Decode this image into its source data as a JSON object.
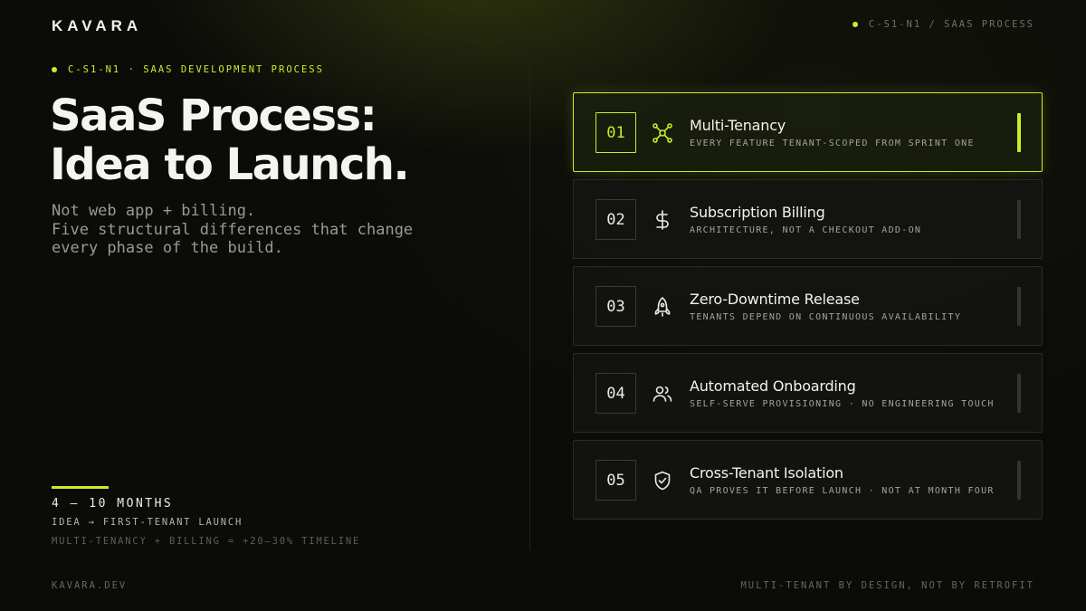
{
  "brand": "KAVARA",
  "header": {
    "section_tag": "C-S1-N1 / SAAS PROCESS"
  },
  "hero": {
    "eyebrow": "C-S1-N1 · SAAS DEVELOPMENT PROCESS",
    "title_line1": "SaaS Process:",
    "title_line2": "Idea to Launch.",
    "subtitle_line1": "Not web app + billing.",
    "subtitle_line2": "Five structural differences that change",
    "subtitle_line3": "every phase of the build."
  },
  "timeline": {
    "range": "4 – 10 MONTHS",
    "description": "IDEA → FIRST-TENANT LAUNCH",
    "note": "MULTI-TENANCY + BILLING = +20–30% TIMELINE"
  },
  "footer": {
    "left": "KAVARA.DEV",
    "right": "MULTI-TENANT BY DESIGN, NOT BY RETROFIT"
  },
  "accent_color": "#c6ef2a",
  "cards": [
    {
      "number": "01",
      "title": "Multi-Tenancy",
      "subtitle": "EVERY FEATURE TENANT-SCOPED FROM SPRINT ONE",
      "icon": "network-nodes-icon",
      "active": true
    },
    {
      "number": "02",
      "title": "Subscription Billing",
      "subtitle": "ARCHITECTURE, NOT A CHECKOUT ADD-ON",
      "icon": "dollar-icon",
      "active": false
    },
    {
      "number": "03",
      "title": "Zero-Downtime Release",
      "subtitle": "TENANTS DEPEND ON CONTINUOUS AVAILABILITY",
      "icon": "rocket-icon",
      "active": false
    },
    {
      "number": "04",
      "title": "Automated Onboarding",
      "subtitle": "SELF-SERVE PROVISIONING · NO ENGINEERING TOUCH",
      "icon": "users-icon",
      "active": false
    },
    {
      "number": "05",
      "title": "Cross-Tenant Isolation",
      "subtitle": "QA PROVES IT BEFORE LAUNCH · NOT AT MONTH FOUR",
      "icon": "shield-check-icon",
      "active": false
    }
  ]
}
